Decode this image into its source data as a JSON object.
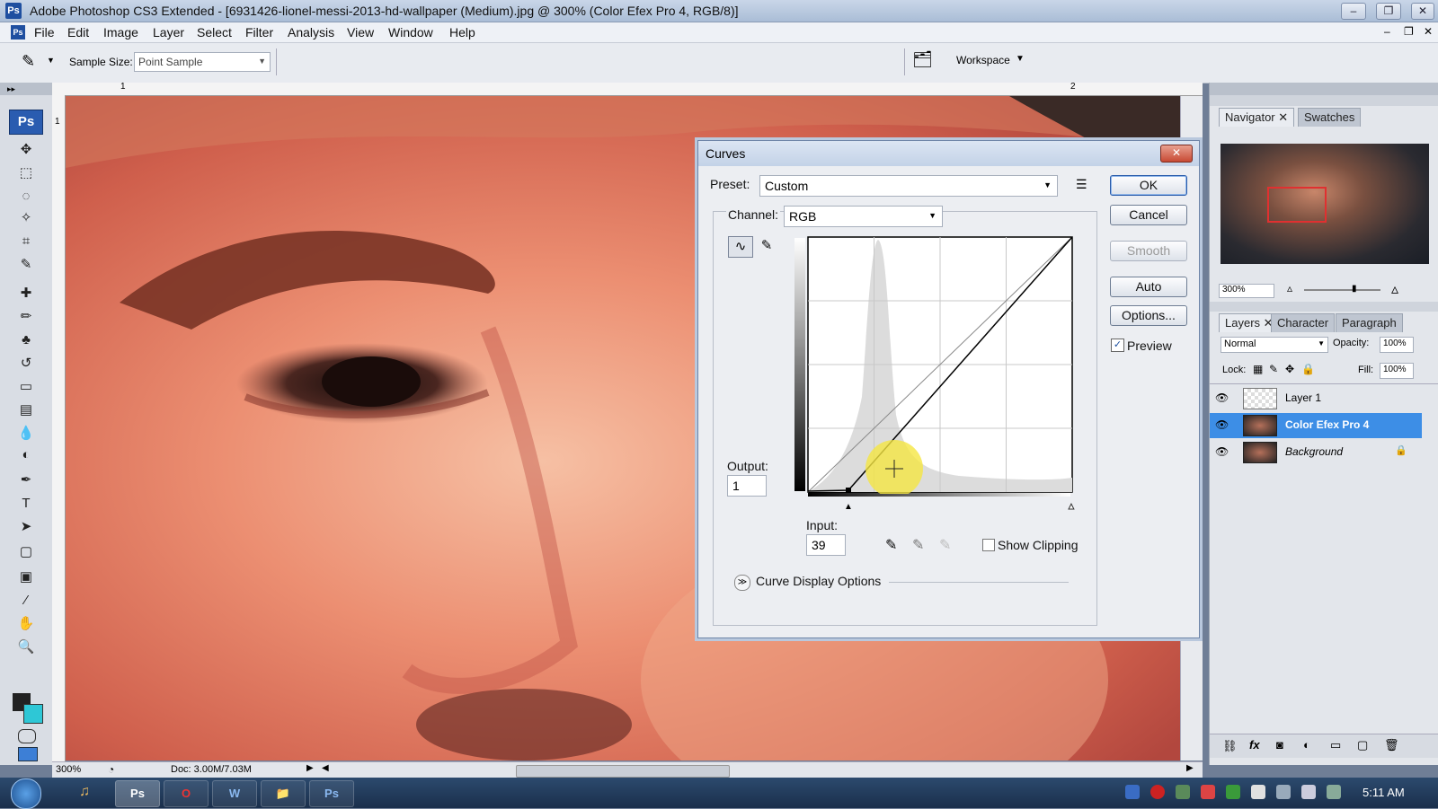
{
  "window": {
    "title": "Adobe Photoshop CS3 Extended - [6931426-lionel-messi-2013-hd-wallpaper (Medium).jpg @ 300% (Color Efex Pro 4, RGB/8)]",
    "app_icon": "Ps",
    "minimize": "–",
    "restore": "❐",
    "close": "✕"
  },
  "menubar": {
    "items": [
      "File",
      "Edit",
      "Image",
      "Layer",
      "Select",
      "Filter",
      "Analysis",
      "View",
      "Window",
      "Help"
    ]
  },
  "options_bar": {
    "sample_size_label": "Sample Size:",
    "sample_size_value": "Point Sample",
    "workspace_label": "Workspace"
  },
  "toolbox": {
    "logo": "Ps",
    "tools": [
      {
        "name": "move-tool",
        "glyph": "✥"
      },
      {
        "name": "marquee-tool",
        "glyph": "⬚"
      },
      {
        "name": "lasso-tool",
        "glyph": "◌"
      },
      {
        "name": "magic-wand-tool",
        "glyph": "✧"
      },
      {
        "name": "crop-tool",
        "glyph": "⌗"
      },
      {
        "name": "eyedropper-tool",
        "glyph": "✎"
      },
      {
        "name": "healing-brush-tool",
        "glyph": "✚"
      },
      {
        "name": "brush-tool",
        "glyph": "✏"
      },
      {
        "name": "clone-stamp-tool",
        "glyph": "♣"
      },
      {
        "name": "history-brush-tool",
        "glyph": "↺"
      },
      {
        "name": "eraser-tool",
        "glyph": "▭"
      },
      {
        "name": "gradient-tool",
        "glyph": "▤"
      },
      {
        "name": "blur-tool",
        "glyph": "💧"
      },
      {
        "name": "dodge-tool",
        "glyph": "◐"
      },
      {
        "name": "pen-tool",
        "glyph": "✒"
      },
      {
        "name": "type-tool",
        "glyph": "T"
      },
      {
        "name": "path-selection-tool",
        "glyph": "➤"
      },
      {
        "name": "shape-tool",
        "glyph": "▢"
      },
      {
        "name": "notes-tool",
        "glyph": "▣"
      },
      {
        "name": "eyedropper-active-tool",
        "glyph": "⁄"
      },
      {
        "name": "hand-tool",
        "glyph": "✋"
      },
      {
        "name": "zoom-tool",
        "glyph": "🔍"
      }
    ]
  },
  "rulers": {
    "h_marks": [
      "1",
      "2"
    ],
    "v_marks": [
      "1"
    ]
  },
  "statusbar": {
    "zoom": "300%",
    "doc": "Doc: 3.00M/7.03M"
  },
  "curves_dialog": {
    "title": "Curves",
    "preset_label": "Preset:",
    "preset_value": "Custom",
    "channel_label": "Channel:",
    "channel_value": "RGB",
    "output_label": "Output:",
    "output_value": "1",
    "input_label": "Input:",
    "input_value": "39",
    "show_clipping_label": "Show Clipping",
    "curve_display_options_label": "Curve Display Options",
    "buttons": {
      "ok": "OK",
      "cancel": "Cancel",
      "smooth": "Smooth",
      "auto": "Auto",
      "options": "Options..."
    },
    "preview_label": "Preview",
    "preview_checked": true
  },
  "navigator_panel": {
    "tabs": [
      "Navigator",
      "Swatches"
    ],
    "zoom_value": "300%"
  },
  "layers_panel": {
    "tabs": [
      "Layers",
      "Character",
      "Paragraph"
    ],
    "blend_mode": "Normal",
    "opacity_label": "Opacity:",
    "opacity_value": "100%",
    "lock_label": "Lock:",
    "fill_label": "Fill:",
    "fill_value": "100%",
    "layers": [
      {
        "name": "Layer 1",
        "selected": false
      },
      {
        "name": "Color Efex Pro 4",
        "selected": true
      },
      {
        "name": "Background",
        "selected": false
      }
    ]
  },
  "taskbar": {
    "clock": "5:11 AM",
    "apps": [
      "Ps",
      "O",
      "W",
      "📁",
      "Ps"
    ]
  },
  "colors": {
    "selected_layer": "#3d8ee6",
    "dialog_border": "#6e85a8",
    "cursor_highlight": "#f5e642"
  }
}
